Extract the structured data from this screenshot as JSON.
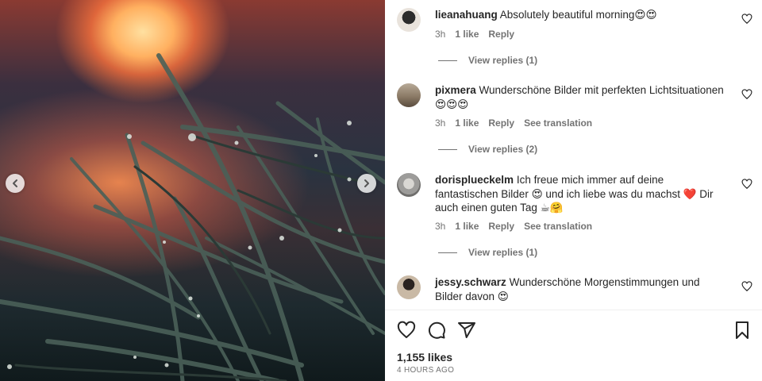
{
  "post": {
    "likes": "1,155 likes",
    "time_ago": "4 HOURS AGO"
  },
  "comments": [
    {
      "username": "lieanahuang",
      "text": "Absolutely beautiful morning😍😍",
      "time": "3h",
      "likes": "1 like",
      "reply": "Reply",
      "translate": "",
      "view_replies": "View replies (1)"
    },
    {
      "username": "pixmera",
      "text": "Wunderschöne Bilder mit perfekten Lichtsituationen😍😍😍",
      "time": "3h",
      "likes": "1 like",
      "reply": "Reply",
      "translate": "See translation",
      "view_replies": "View replies (2)"
    },
    {
      "username": "dorisplueckelm",
      "text": "Ich freue mich immer auf deine fantastischen Bilder 😍 und ich liebe was du machst ❤️ Dir auch einen guten Tag ☕🤗",
      "time": "3h",
      "likes": "1 like",
      "reply": "Reply",
      "translate": "See translation",
      "view_replies": "View replies (1)"
    },
    {
      "username": "jessy.schwarz",
      "text": "Wunderschöne Morgenstimmungen und Bilder davon 😍"
    }
  ],
  "icons": {
    "prev": "chevron-left-icon",
    "next": "chevron-right-icon",
    "like": "heart-icon",
    "comment": "comment-icon",
    "share": "paper-plane-icon",
    "save": "bookmark-icon"
  }
}
